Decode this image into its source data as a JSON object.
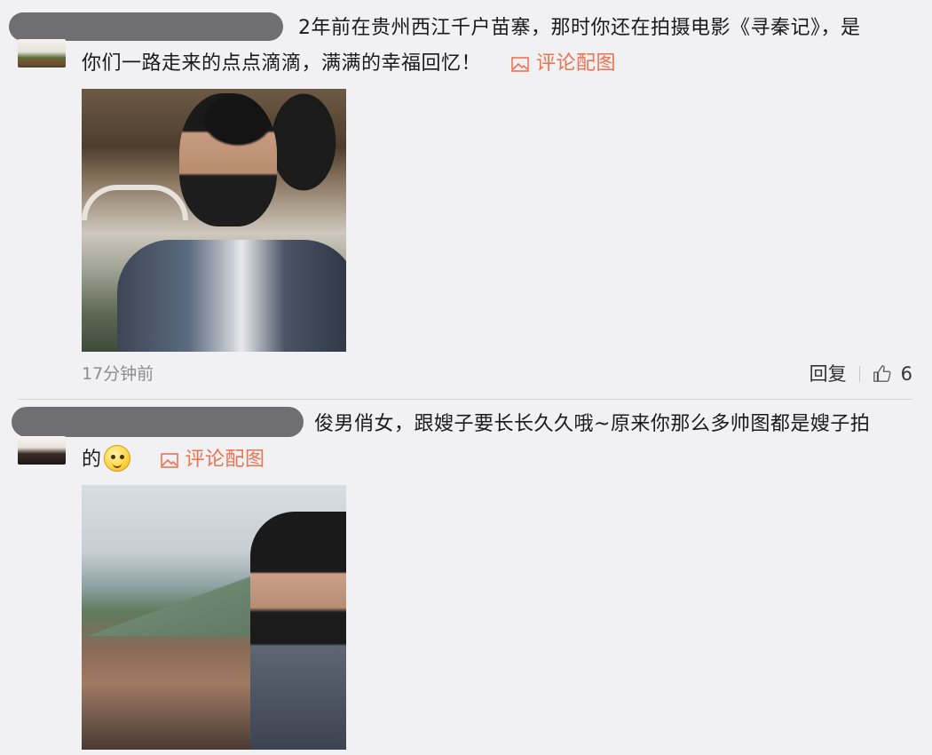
{
  "comments": [
    {
      "line1": "2年前在贵州西江千户苗寨，那时你还在拍摄电影《寻秦记》，是",
      "line2": "你们一路走来的点点滴滴，满满的幸福回忆！",
      "pic_label": "评论配图",
      "time": "17分钟前",
      "reply_label": "回复",
      "like_count": "6"
    },
    {
      "line1": "俊男俏女，跟嫂子要长长久久哦~原来你那么多帅图都是嫂子拍",
      "line2": "的",
      "emoji_icon": "smirk-emoji-icon",
      "pic_label": "评论配图"
    }
  ],
  "colors": {
    "accent": "#eb7350",
    "background": "#f1f1f3",
    "mask": "#6f6f73"
  }
}
